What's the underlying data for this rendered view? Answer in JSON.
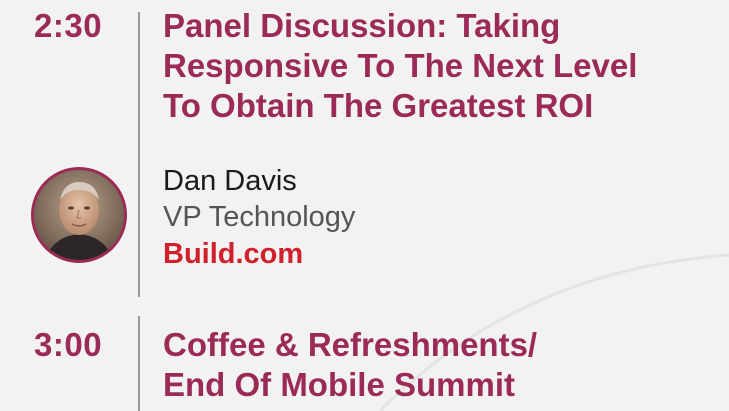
{
  "schedule": [
    {
      "time": "2:30",
      "title_lines": [
        "Panel Discussion: Taking",
        "Responsive To The Next Level",
        "To Obtain The Greatest ROI"
      ],
      "speaker": {
        "name": "Dan Davis",
        "role": "VP Technology",
        "company": "Build.com"
      }
    },
    {
      "time": "3:00",
      "title_lines": [
        "Coffee & Refreshments/",
        "End Of Mobile Summit"
      ]
    }
  ],
  "colors": {
    "accent": "#9b2a57",
    "company_link": "#d0202b",
    "background": "#f2f2f2",
    "divider": "#9a9a9a"
  }
}
